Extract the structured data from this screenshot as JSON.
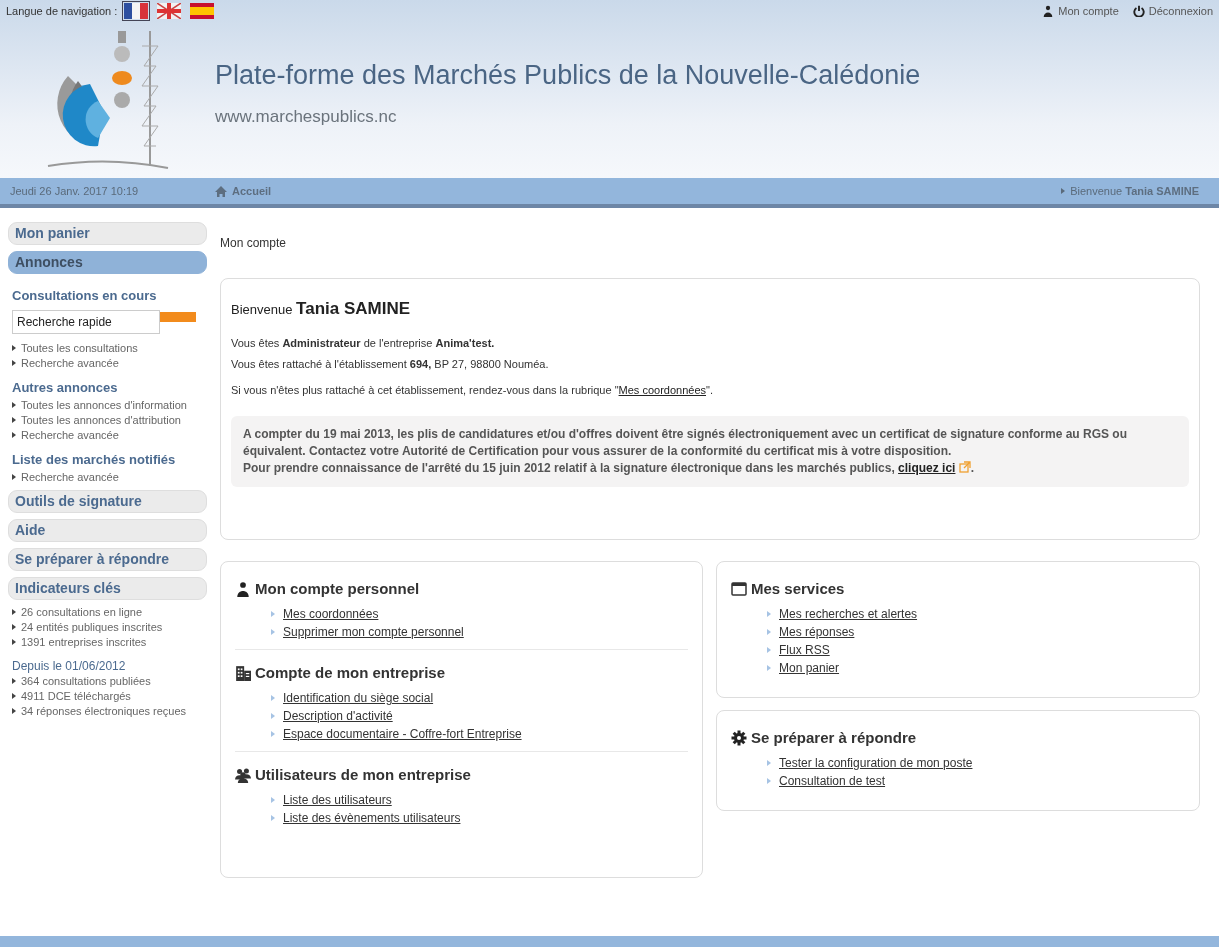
{
  "language_bar": {
    "label": "Langue de navigation :",
    "flags": [
      {
        "kind": "fr",
        "selected": true
      },
      {
        "kind": "uk",
        "selected": false
      },
      {
        "kind": "es",
        "selected": false
      }
    ]
  },
  "user_links": [
    {
      "kind": "account",
      "label": "Mon compte"
    },
    {
      "kind": "logout",
      "label": "Déconnexion"
    }
  ],
  "site": {
    "title": "Plate-forme des Marchés Publics de la Nouvelle-Calédonie",
    "url": "www.marchespublics.nc"
  },
  "nav_bar": {
    "date": "Jeudi 26 Janv. 2017 10:19",
    "home": "Accueil",
    "welcome": "Bienvenue **Tania SAMINE**"
  },
  "sidebar": {
    "items": [
      {
        "kind": "tab",
        "label": "Mon panier",
        "selected": false
      },
      {
        "kind": "tab",
        "label": "Annonces",
        "selected": true
      },
      {
        "kind": "heading",
        "label": "Consultations en cours"
      },
      {
        "kind": "search",
        "placeholder": "Recherche rapide"
      },
      {
        "kind": "link",
        "label": "Toutes les consultations"
      },
      {
        "kind": "link",
        "label": "Recherche avancée"
      },
      {
        "kind": "heading",
        "label": "Autres annonces"
      },
      {
        "kind": "link",
        "label": "Toutes les annonces d'information"
      },
      {
        "kind": "link",
        "label": "Toutes les annonces d'attribution"
      },
      {
        "kind": "link",
        "label": "Recherche avancée"
      },
      {
        "kind": "heading",
        "label": "Liste des marchés notifiés"
      },
      {
        "kind": "link",
        "label": "Recherche avancée"
      },
      {
        "kind": "tab",
        "label": "Outils de signature",
        "selected": false
      },
      {
        "kind": "tab",
        "label": "Aide",
        "selected": false
      },
      {
        "kind": "tab",
        "label": "Se préparer à répondre",
        "selected": false
      },
      {
        "kind": "tab",
        "label": "Indicateurs clés",
        "selected": false
      },
      {
        "kind": "link",
        "label": "26 consultations en ligne"
      },
      {
        "kind": "link",
        "label": "24 entités publiques inscrites"
      },
      {
        "kind": "link",
        "label": "1391 entreprises inscrites"
      },
      {
        "kind": "subheading",
        "label": "Depuis le 01/06/2012"
      },
      {
        "kind": "link",
        "label": "364 consultations publiées"
      },
      {
        "kind": "link",
        "label": "4911 DCE téléchargés"
      },
      {
        "kind": "link",
        "label": "34 réponses électroniques reçues"
      }
    ]
  },
  "breadcrumb": "Mon compte",
  "welcome": {
    "heading": "Bienvenue **Tania SAMINE**",
    "lines": [
      "Vous êtes **Administrateur** de l'entreprise **Anima'test.**",
      "Vous êtes rattaché à l'établissement **694,** BP 27, 98800 Nouméa."
    ],
    "hint": {
      "before": "Si vous n'êtes plus rattaché à cet établissement, rendez-vous dans la rubrique \"",
      "link": "Mes coordonnées",
      "after": "\"."
    },
    "notice": {
      "text": "A compter du 19 mai 2013, les plis de candidatures et/ou d'offres doivent être signés électroniquement avec un certificat de signature conforme au RGS ou équivalent. Contactez votre Autorité de Certification pour vous assurer de la conformité du certificat mis à votre disposition.",
      "before": "Pour prendre connaissance de l'arrêté du 15 juin 2012 relatif à la signature électronique dans les marchés publics,",
      "link": "cliquez ici",
      "after": "."
    }
  },
  "cards": [
    {
      "sections": [
        {
          "kind": "person",
          "title": "Mon compte personnel",
          "links": [
            "Mes coordonnées",
            "Supprimer mon compte personnel"
          ]
        },
        {
          "kind": "building",
          "title": "Compte de mon entreprise",
          "links": [
            "Identification du siège social",
            "Description d'activité",
            "Espace documentaire - Coffre-fort Entreprise"
          ]
        },
        {
          "kind": "users",
          "title": "Utilisateurs de mon entreprise",
          "links": [
            "Liste des utilisateurs",
            "Liste des évènements utilisateurs"
          ]
        }
      ]
    },
    {
      "sections": [
        {
          "kind": "window",
          "title": "Mes services",
          "links": [
            "Mes recherches et alertes",
            "Mes réponses",
            "Flux RSS",
            "Mon panier"
          ]
        }
      ]
    },
    {
      "sections": [
        {
          "kind": "gear",
          "title": "Se préparer à répondre",
          "links": [
            "Tester la configuration de mon poste",
            "Consultation de test"
          ]
        }
      ]
    }
  ]
}
